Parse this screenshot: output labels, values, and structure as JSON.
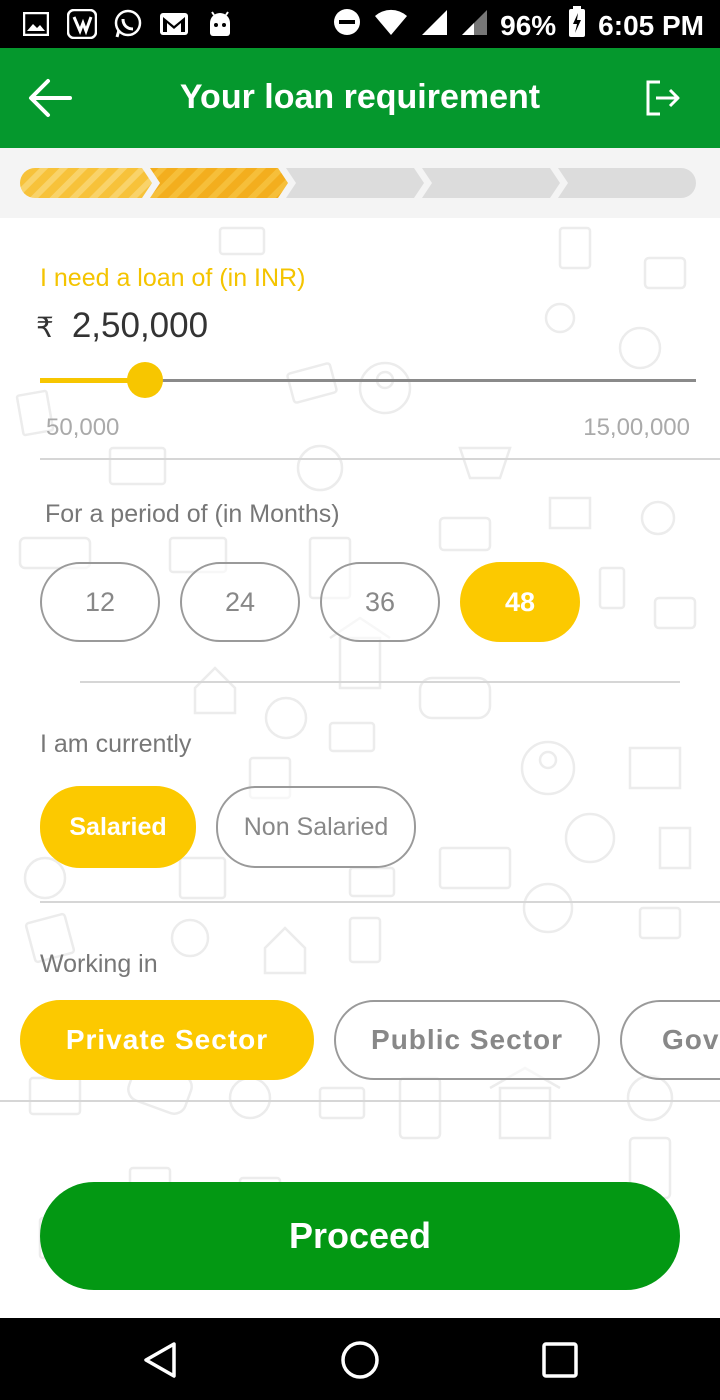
{
  "status_bar": {
    "icons": [
      "gallery-icon",
      "vivo-app-icon",
      "whatsapp-icon",
      "gmail-icon",
      "android-icon"
    ],
    "battery": "96%",
    "time": "6:05 PM"
  },
  "app_bar": {
    "title": "Your loan requirement"
  },
  "progress": {
    "total_steps": 5,
    "completed_steps": 2
  },
  "loan": {
    "label": "I need a loan of (in INR)",
    "currency_symbol": "₹",
    "amount": "2,50,000",
    "min": "50,000",
    "max": "15,00,000",
    "slider_fraction": 0.16
  },
  "period": {
    "label": "For a period of (in Months)",
    "options": [
      "12",
      "24",
      "36",
      "48"
    ],
    "selected": "48"
  },
  "employment": {
    "label": "I am currently",
    "options": [
      "Salaried",
      "Non Salaried"
    ],
    "selected": "Salaried"
  },
  "sector": {
    "label": "Working in",
    "options": [
      "Private Sector",
      "Public Sector",
      "Gove"
    ],
    "selected": "Private Sector"
  },
  "proceed_label": "Proceed",
  "colors": {
    "app_bar": "#05982d",
    "accent_yellow": "#fcc900",
    "proceed_green": "#039813"
  }
}
